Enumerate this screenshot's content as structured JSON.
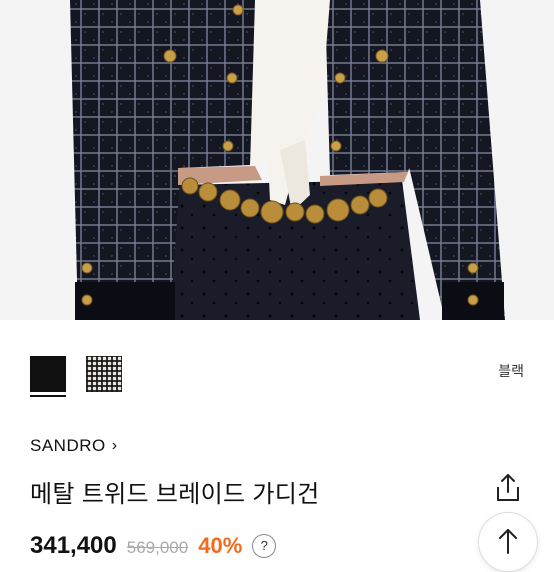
{
  "product": {
    "color_selected": "블랙",
    "swatches": [
      {
        "name": "black",
        "color": "#111111"
      },
      {
        "name": "check-tweed",
        "color": "#e8e6df"
      }
    ],
    "brand": "SANDRO",
    "brand_chevron": "›",
    "title": "메탈 트위드 브레이드 가디건",
    "price": "341,400",
    "original_price": "569,000",
    "discount": "40%",
    "help_symbol": "?"
  },
  "colors": {
    "accent_discount": "#f26b1d",
    "text": "#111111",
    "muted": "#aaaaaa"
  },
  "icons": {
    "share": "share-icon",
    "scroll_top": "arrow-up-icon"
  }
}
